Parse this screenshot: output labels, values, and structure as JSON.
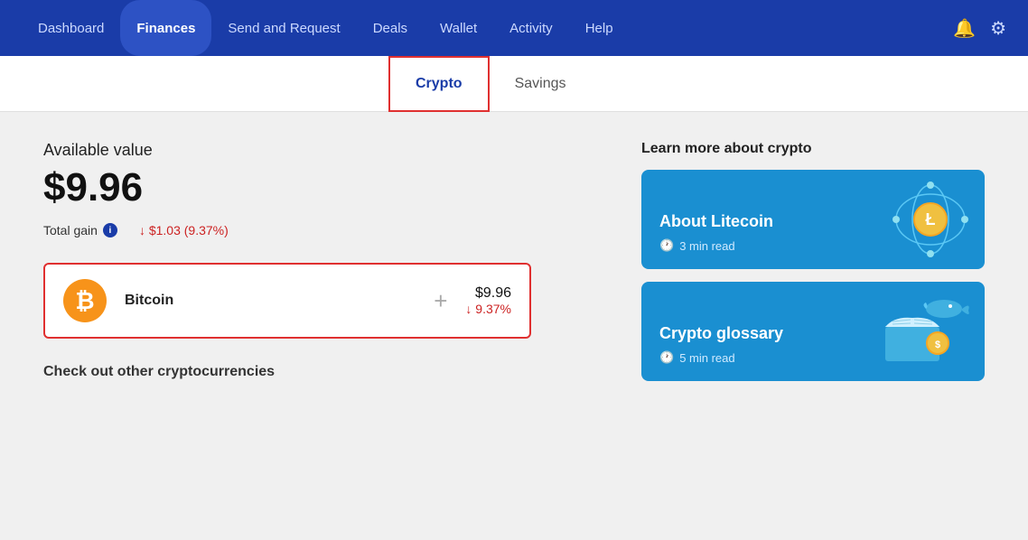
{
  "navbar": {
    "items": [
      {
        "id": "dashboard",
        "label": "Dashboard",
        "active": false
      },
      {
        "id": "finances",
        "label": "Finances",
        "active": true
      },
      {
        "id": "send-request",
        "label": "Send and Request",
        "active": false
      },
      {
        "id": "deals",
        "label": "Deals",
        "active": false
      },
      {
        "id": "wallet",
        "label": "Wallet",
        "active": false
      },
      {
        "id": "activity",
        "label": "Activity",
        "active": false
      },
      {
        "id": "help",
        "label": "Help",
        "active": false
      }
    ]
  },
  "tabs": [
    {
      "id": "crypto",
      "label": "Crypto",
      "active": true
    },
    {
      "id": "savings",
      "label": "Savings",
      "active": false
    }
  ],
  "main": {
    "available_label": "Available value",
    "available_value": "$9.96",
    "total_gain_label": "Total gain",
    "total_gain_value": "↓ $1.03 (9.37%)",
    "bitcoin": {
      "name": "Bitcoin",
      "amount": "$9.96",
      "change": "↓ 9.37%"
    },
    "check_other": "Check out other cryptocurrencies"
  },
  "learn": {
    "title": "Learn more about crypto",
    "cards": [
      {
        "id": "litecoin",
        "title": "About Litecoin",
        "time": "3 min read"
      },
      {
        "id": "glossary",
        "title": "Crypto glossary",
        "time": "5 min read"
      }
    ]
  }
}
